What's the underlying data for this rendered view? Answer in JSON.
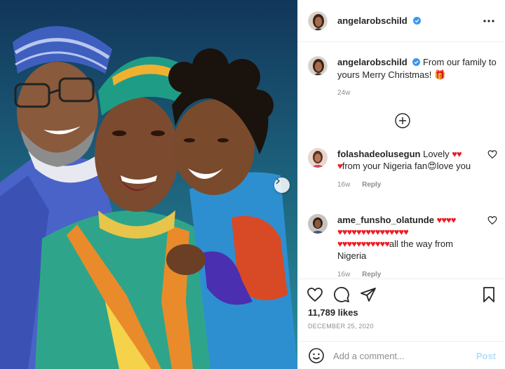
{
  "post": {
    "username": "angelarobschild",
    "caption_text": "From our family to yours Merry Christmas!",
    "caption_emoji": "🎁",
    "caption_time": "24w",
    "likes": "11,789 likes",
    "date": "DECEMBER 25, 2020"
  },
  "comments": [
    {
      "username": "folashadeolusegun",
      "text_before": "Lovely",
      "hearts_1": "♥♥",
      "hearts_2": "♥",
      "text_after": "from your Nigeria fan",
      "emoji": "😍",
      "text_end": "love you",
      "time": "16w",
      "reply_label": "Reply"
    },
    {
      "username": "ame_funsho_olatunde",
      "hearts_1": "♥♥♥♥",
      "hearts_2": "♥♥♥♥♥♥♥♥♥♥♥♥♥♥♥",
      "hearts_3": "♥♥♥♥♥♥♥♥♥♥♥",
      "text_after": "all the way from Nigeria",
      "time": "16w",
      "reply_label": "Reply"
    }
  ],
  "comment_box": {
    "placeholder": "Add a comment...",
    "post_label": "Post"
  },
  "colors": {
    "verified": "#3897f0",
    "hearts": "#ed1c24",
    "post_disabled": "#b2dffc"
  },
  "icons": [
    "verified-icon",
    "more-options-icon",
    "load-more-icon",
    "heart-icon",
    "comment-icon",
    "share-icon",
    "bookmark-icon",
    "emoji-icon",
    "chevron-right-icon"
  ]
}
